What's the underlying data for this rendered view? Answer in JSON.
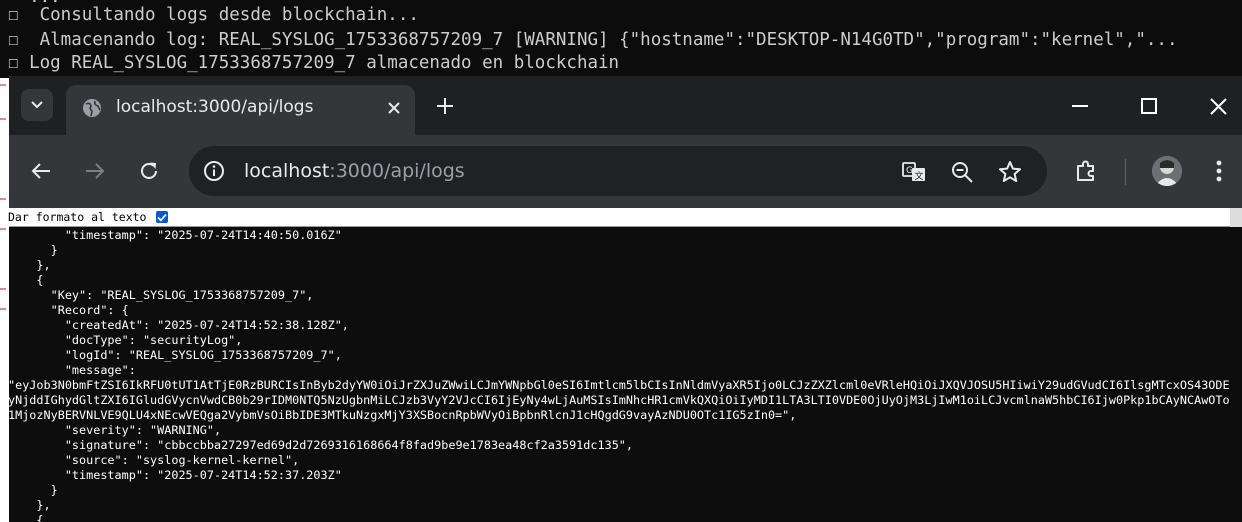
{
  "terminal": {
    "partial_line": "  ...",
    "lines": [
      "☐  Consultando logs desde blockchain...",
      "☐  Almacenando log: REAL_SYSLOG_1753368757209_7 [WARNING] {\"hostname\":\"DESKTOP-N14G0TD\",\"program\":\"kernel\",\"...",
      "☐ Log REAL_SYSLOG_1753368757209_7 almacenado en blockchain"
    ]
  },
  "browser": {
    "tab": {
      "title": "localhost:3000/api/logs",
      "icon": "globe-icon"
    },
    "omnibox": {
      "host": "localhost",
      "path": ":3000/api/logs"
    },
    "icons": [
      "tab-search-icon",
      "close-icon",
      "plus-icon",
      "minimize-icon",
      "maximize-icon",
      "close-window-icon",
      "back-icon",
      "forward-icon",
      "reload-icon",
      "info-icon",
      "translate-icon",
      "zoom-icon",
      "star-icon",
      "extensions-icon",
      "avatar",
      "menu-icon"
    ],
    "colors": {
      "frame": "#1f2022",
      "toolbar": "#35363a",
      "omnibox": "#202124",
      "text": "#e8eaed",
      "checkbox": "#0b57d0"
    }
  },
  "pretty_print": {
    "label": "Dar formato al texto",
    "checked": true
  },
  "json_lines": {
    "l1": "        \"timestamp\": \"2025-07-24T14:40:50.016Z\"",
    "l2": "      }",
    "l3": "    },",
    "l4": "    {",
    "l5": "      \"Key\": \"REAL_SYSLOG_1753368757209_7\",",
    "l6": "      \"Record\": {",
    "l7": "        \"createdAt\": \"2025-07-24T14:52:38.128Z\",",
    "l8": "        \"docType\": \"securityLog\",",
    "l9": "        \"logId\": \"REAL_SYSLOG_1753368757209_7\",",
    "l10": "        \"message\":",
    "message": "\"eyJob3N0bmFtZSI6IkRFU0tUT1AtTjE0RzBURCIsInByb2dyYW0iOiJrZXJuZWwiLCJmYWNpbGl0eSI6Imtlcm5lbCIsInNldmVyaXR5Ijo0LCJzZXZlcml0eVRleHQiOiJXQVJOSU5HIiwiY29udGVudCI6IlsgMTcxOS43ODEyNjddIGhydGltZXI6IGludGVycnVwdCB0b29rIDM0NTQ5NzUgbnMiLCJzb3VyY2VJcCI6IjEyNy4wLjAuMSIsImNhcHR1cmVkQXQiOiIyMDI1LTA3LTI0VDE0OjUyOjM3LjIwM1oiLCJvcmlnaW5hbCI6Ijw0Pkp1bCAyNCAwOTo1MjozNyBERVNLVE9QLU4xNEcwVEQga2VybmVsOiBbIDE3MTkuNzgxMjY3XSBocnRpbWVyOiBpbnRlcnJ1cHQgdG9vayAzNDU0OTc1IG5zIn0=\",",
    "l11": "        \"severity\": \"WARNING\",",
    "l12": "        \"signature\": \"cbbccbba27297ed69d2d7269316168664f8fad9be9e1783ea48cf2a3591dc135\",",
    "l13": "        \"source\": \"syslog-kernel-kernel\",",
    "l14": "        \"timestamp\": \"2025-07-24T14:52:37.203Z\"",
    "l15": "      }",
    "l16": "    },",
    "l17": "    {"
  }
}
